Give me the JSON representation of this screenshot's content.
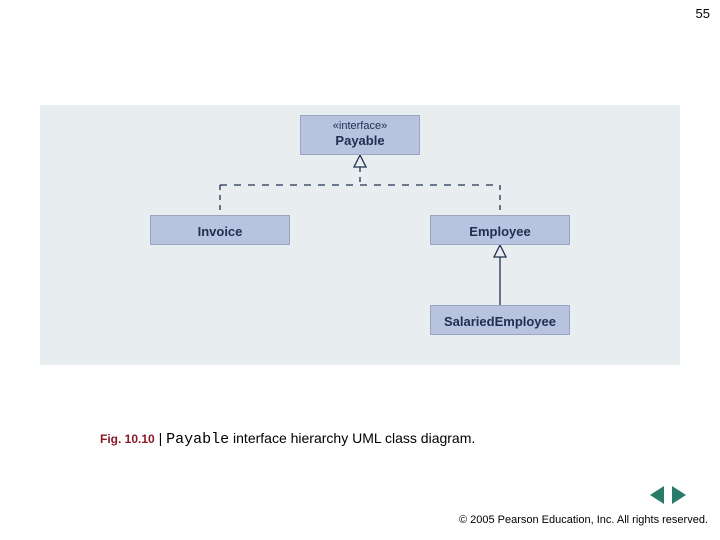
{
  "page_number": "55",
  "diagram": {
    "interface_stereotype": "«interface»",
    "payable": "Payable",
    "invoice": "Invoice",
    "employee": "Employee",
    "salaried": "SalariedEmployee"
  },
  "caption": {
    "fig_label": "Fig. 10.10",
    "sep": " | ",
    "code": "Payable",
    "rest": " interface hierarchy UML class diagram."
  },
  "copyright": "© 2005 Pearson Education, Inc.  All rights reserved."
}
